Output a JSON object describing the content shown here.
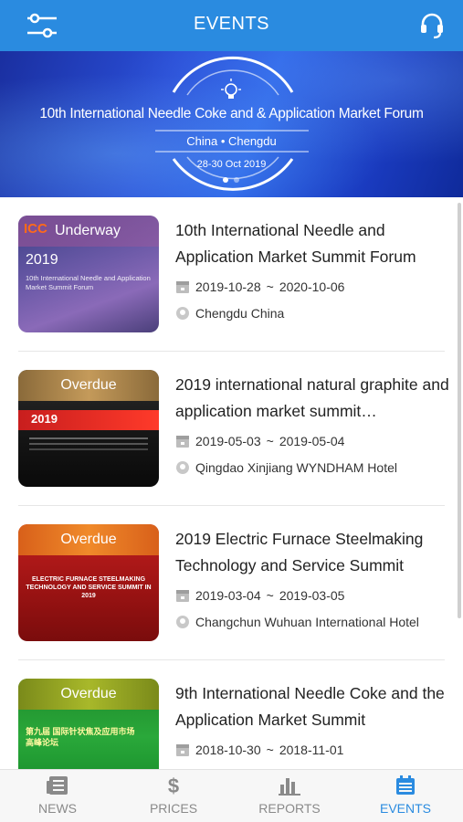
{
  "header": {
    "title": "EVENTS",
    "filter_icon": "sliders-icon",
    "support_icon": "headset-icon"
  },
  "banner": {
    "title": "10th International Needle Coke and & Application Market Forum",
    "location": "China • Chengdu",
    "dates": "28-30 Oct 2019",
    "slide_count": 2,
    "active_slide": 1
  },
  "events": [
    {
      "status": "Underway",
      "thumb_brand": "ICC",
      "thumb_year": "2019",
      "title": "10th International Needle and Application Market Summit Forum",
      "start": "2019-10-28",
      "end": "2020-10-06",
      "location": "Chengdu China"
    },
    {
      "status": "Overdue",
      "thumb_year": "2019",
      "title": "2019 international natural graphite and application market summit…",
      "start": "2019-05-03",
      "end": "2019-05-04",
      "location": "Qingdao Xinjiang WYNDHAM Hotel"
    },
    {
      "status": "Overdue",
      "thumb_text": "ELECTRIC FURNACE STEELMAKING TECHNOLOGY AND SERVICE SUMMIT IN 2019",
      "title": "2019 Electric Furnace Steelmaking Technology and Service Summit",
      "start": "2019-03-04",
      "end": "2019-03-05",
      "location": "Changchun Wuhuan International Hotel"
    },
    {
      "status": "Overdue",
      "thumb_text": "第九届 国际针状焦及应用市场高峰论坛",
      "title": "9th International Needle Coke and the Application Market Summit",
      "start": "2018-10-30",
      "end": "2018-11-01",
      "location": ""
    }
  ],
  "date_separator": "~",
  "nav": {
    "items": [
      {
        "label": "NEWS",
        "icon": "newspaper-icon"
      },
      {
        "label": "PRICES",
        "icon": "dollar-icon"
      },
      {
        "label": "REPORTS",
        "icon": "bar-chart-icon"
      },
      {
        "label": "EVENTS",
        "icon": "calendar-icon"
      }
    ],
    "active": "EVENTS"
  },
  "colors": {
    "primary": "#2a8be0",
    "nav_inactive": "#8a8a8a"
  }
}
